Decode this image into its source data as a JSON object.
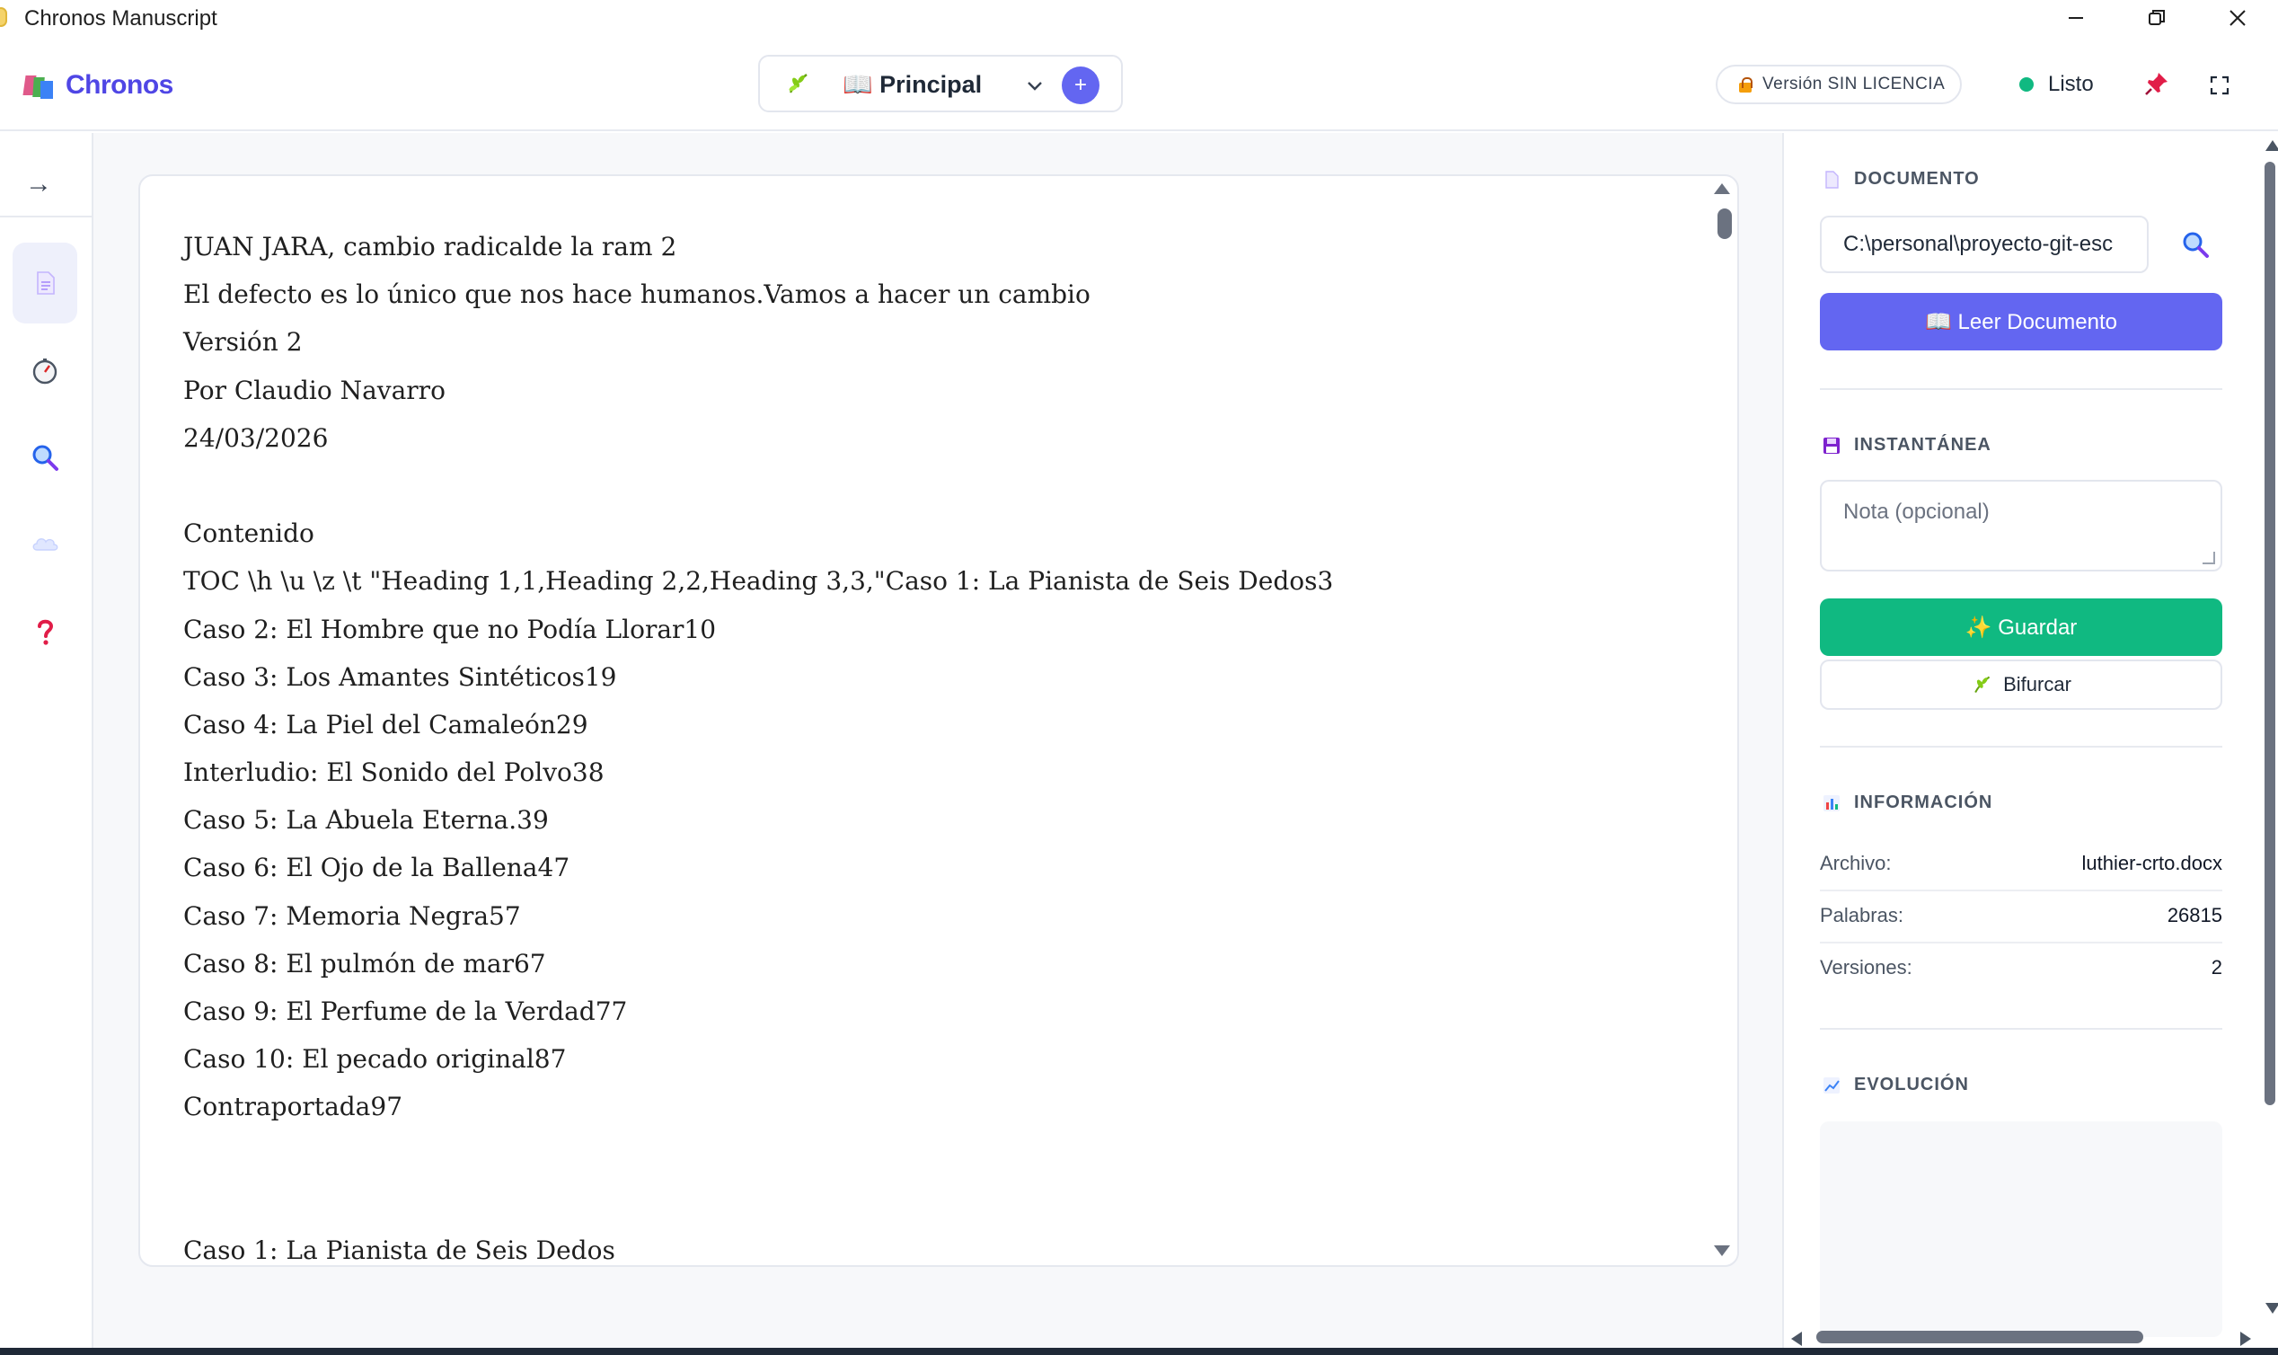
{
  "window": {
    "title": "Chronos Manuscript"
  },
  "header": {
    "brand": "Chronos",
    "branch_label": "📖 Principal",
    "add_branch_symbol": "+",
    "license_label": "Versión SIN LICENCIA",
    "status_label": "Listo",
    "status_color": "#10b981"
  },
  "rail": {
    "collapse_symbol": "→",
    "items": [
      "document-icon",
      "history-clock-icon",
      "search-icon",
      "cloud-icon",
      "help-icon"
    ],
    "active_item": "document-icon"
  },
  "document": {
    "lines": [
      "JUAN JARA, cambio radicalde la ram 2",
      "El defecto es lo único que nos hace humanos.Vamos a hacer un cambio",
      "Versión 2",
      "Por Claudio Navarro",
      "24/03/2026",
      "",
      "Contenido",
      "TOC \\h \\u \\z \\t \"Heading 1,1,Heading 2,2,Heading 3,3,\"Caso 1: La Pianista de Seis Dedos3",
      "Caso 2: El Hombre que no Podía Llorar10",
      "Caso 3: Los Amantes Sintéticos19",
      "Caso 4: La Piel del Camaleón29",
      "Interludio: El Sonido del Polvo38",
      "Caso 5: La Abuela Eterna.39",
      "Caso 6: El Ojo de la Ballena47",
      "Caso 7: Memoria Negra57",
      "Caso 8: El pulmón de mar67",
      "Caso 9: El Perfume de la Verdad77",
      "Caso 10: El pecado original87",
      "Contraportada97",
      "",
      "",
      "Caso 1: La Pianista de Seis Dedos"
    ]
  },
  "side": {
    "document": {
      "title": "DOCUMENTO",
      "path_value": "C:\\personal\\proyecto-git-esc",
      "read_button": "📖 Leer Documento"
    },
    "snapshot": {
      "title": "INSTANTÁNEA",
      "note_placeholder": "Nota (opcional)",
      "save_button": "✨ Guardar",
      "fork_button": "Bifurcar"
    },
    "info": {
      "title": "INFORMACIÓN",
      "rows": [
        {
          "key": "Archivo:",
          "value": "luthier-crto.docx"
        },
        {
          "key": "Palabras:",
          "value": "26815"
        },
        {
          "key": "Versiones:",
          "value": "2"
        }
      ]
    },
    "evolution": {
      "title": "EVOLUCIÓN"
    }
  },
  "colors": {
    "accent": "#6366f1",
    "brand": "#4f46e5",
    "success": "#10b981"
  }
}
